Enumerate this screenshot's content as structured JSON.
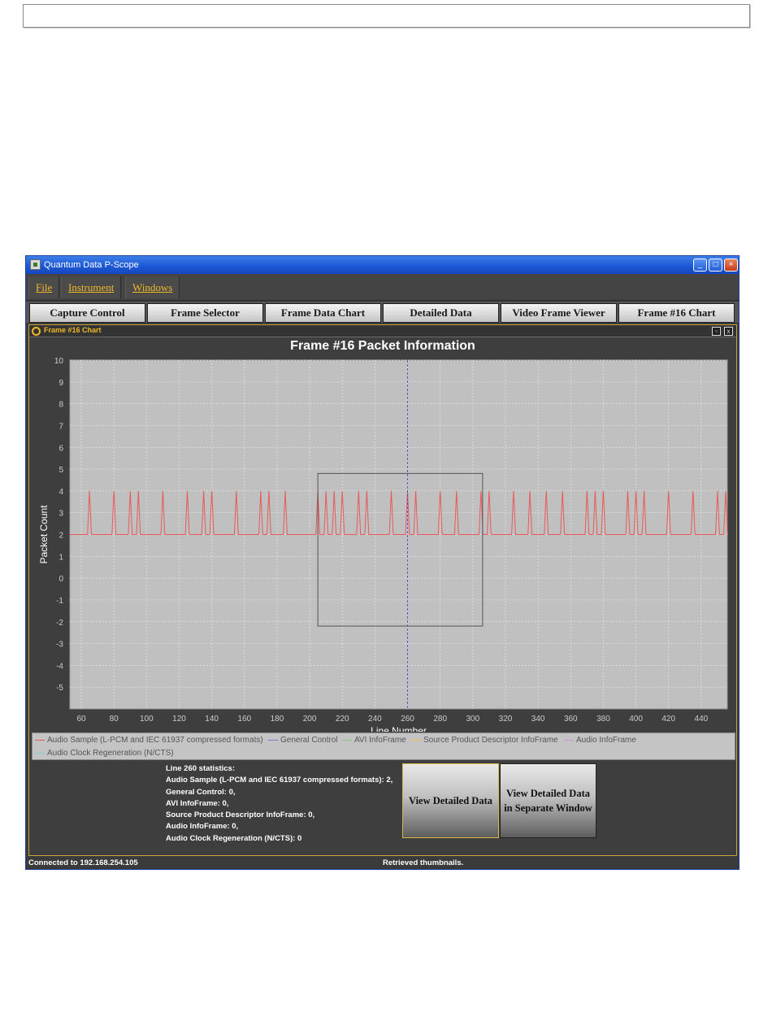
{
  "app": {
    "title": "Quantum Data P-Scope",
    "window_buttons": {
      "minimize": "_",
      "maximize": "□",
      "close": "×"
    }
  },
  "menu": [
    "File",
    "Instrument",
    "Windows"
  ],
  "tabs": [
    "Capture Control",
    "Frame Selector",
    "Frame Data Chart",
    "Detailed Data",
    "Video Frame Viewer",
    "Frame #16 Chart"
  ],
  "internal_frame": {
    "title": "Frame #16 Chart",
    "ctrl_restore": "▫",
    "ctrl_close": "x"
  },
  "chart_data": {
    "type": "line",
    "title": "Frame #16 Packet Information",
    "xlabel": "Line Number",
    "ylabel": "Packet Count",
    "xlim": [
      53,
      456
    ],
    "ylim": [
      -6,
      10
    ],
    "x_ticks": [
      60,
      80,
      100,
      120,
      140,
      160,
      180,
      200,
      220,
      240,
      260,
      280,
      300,
      320,
      340,
      360,
      380,
      400,
      420,
      440
    ],
    "y_ticks": [
      10,
      9,
      8,
      7,
      6,
      5,
      4,
      3,
      2,
      1,
      0,
      -1,
      -2,
      -3,
      -4,
      -5
    ],
    "grid": true,
    "crosshair_x": 260,
    "zoom_box": {
      "x": [
        205,
        306
      ],
      "y": [
        -2.2,
        4.8
      ]
    },
    "series": [
      {
        "name": "Audio Sample (L-PCM and IEC 61937 compressed formats)",
        "color": "#e85a5a",
        "baseline": 2,
        "peak": 4,
        "spike_x": [
          65,
          80,
          90,
          95,
          110,
          125,
          135,
          140,
          155,
          170,
          175,
          185,
          205,
          210,
          215,
          220,
          230,
          235,
          250,
          260,
          265,
          280,
          290,
          305,
          310,
          325,
          335,
          345,
          355,
          370,
          375,
          380,
          395,
          400,
          405,
          420,
          435,
          450,
          455
        ]
      },
      {
        "name": "General Control",
        "color": "#7b7bd8",
        "values_note_free": true
      },
      {
        "name": "AVI InfoFrame",
        "color": "#7fc97f"
      },
      {
        "name": "Source Product Descriptor InfoFrame",
        "color": "#e6c24a"
      },
      {
        "name": "Audio InfoFrame",
        "color": "#d98ad9"
      },
      {
        "name": "Audio Clock Regeneration (N/CTS)",
        "color": "#7fcfcf"
      }
    ]
  },
  "stats": {
    "heading": "Line 260 statistics:",
    "lines": [
      "Audio Sample (L-PCM and IEC 61937 compressed formats): 2,",
      "General Control: 0,",
      "AVI InfoFrame: 0,",
      "Source Product Descriptor InfoFrame: 0,",
      "Audio InfoFrame: 0,",
      "Audio Clock Regeneration (N/CTS): 0"
    ]
  },
  "buttons": {
    "view_detailed": "View Detailed Data",
    "view_separate_line1": "View Detailed Data",
    "view_separate_line2": "in Separate Window"
  },
  "status": {
    "left": "Connected to 192.168.254.105",
    "center": "Retrieved thumbnails."
  }
}
